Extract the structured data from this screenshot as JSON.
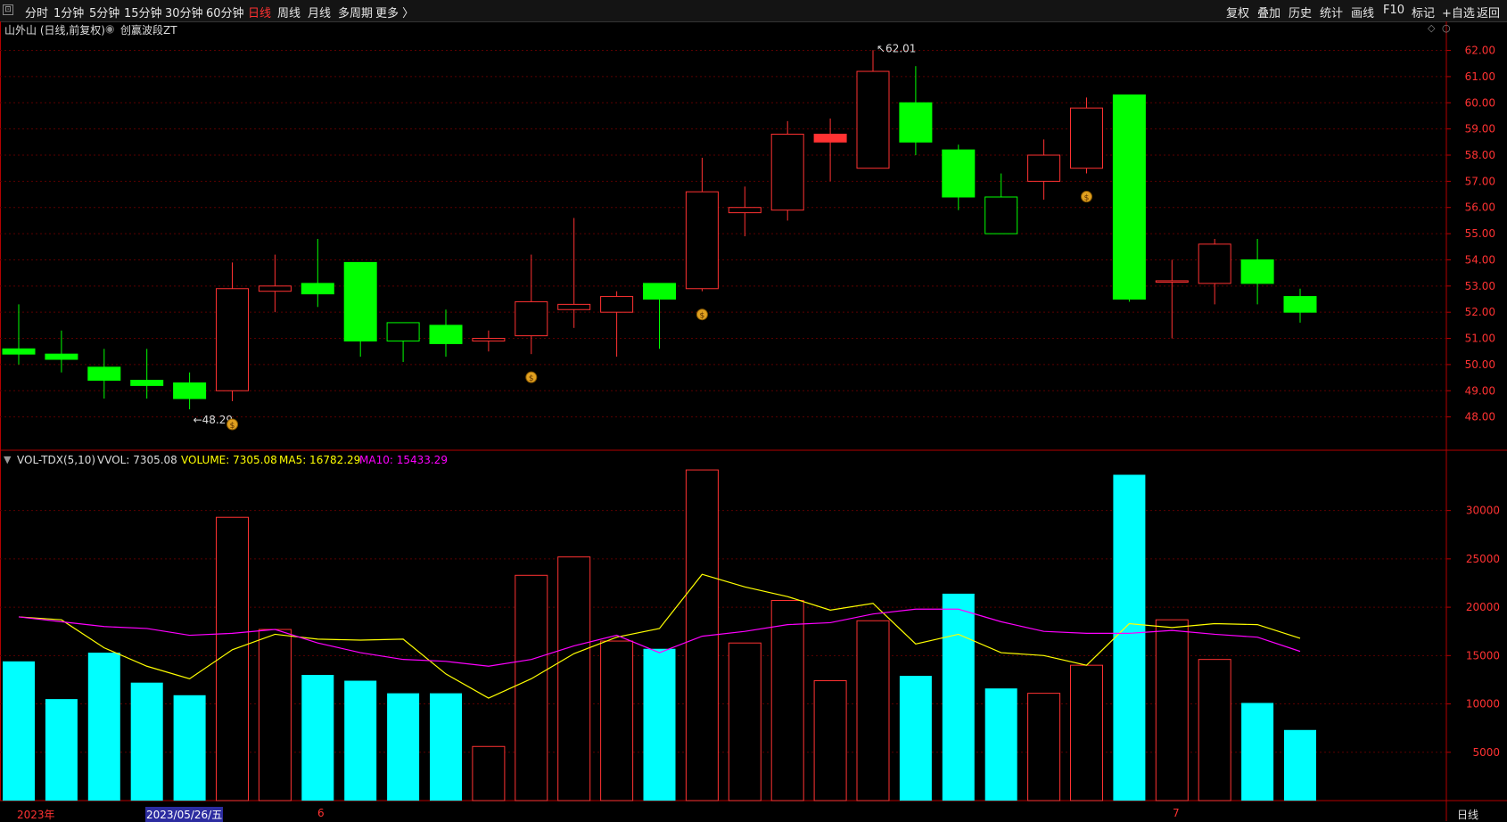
{
  "toolbar": {
    "periods": [
      "分时",
      "1分钟",
      "5分钟",
      "15分钟",
      "30分钟",
      "60分钟",
      "日线",
      "周线",
      "月线",
      "多周期",
      "更多 〉"
    ],
    "active": "日线",
    "right": [
      "复权",
      "叠加",
      "历史",
      "统计",
      "画线",
      "F10",
      "标记",
      "+自选",
      "返回"
    ]
  },
  "price_header": {
    "stock": "山外山 (日线,前复权)",
    "indicator": "创赢波段ZT"
  },
  "volume_header": {
    "name": "VOL-TDX(5,10)",
    "vvol": "VVOL: 7305.08",
    "volume": "VOLUME: 7305.08",
    "ma5": "MA5: 16782.29",
    "ma10": "MA10: 15433.29"
  },
  "bottom": {
    "year": "2023年",
    "date": "2023/05/26/五",
    "m6": "6",
    "m7": "7",
    "period": "日线"
  },
  "colors": {
    "up": "#ff3232",
    "down": "#00ff00",
    "vol_down": "#00ffff",
    "ma5": "#ffff00",
    "ma10": "#ff00ff",
    "axis": "#b40000",
    "grid": "#5a0000"
  },
  "chart_data": [
    {
      "type": "candlestick",
      "ylim": [
        47,
        62.7
      ],
      "y_ticks": [
        48,
        49,
        50,
        51,
        52,
        53,
        54,
        55,
        56,
        57,
        58,
        59,
        60,
        61,
        62
      ],
      "annotations": [
        {
          "text": "48.29",
          "index": 4
        },
        {
          "text": "62.01",
          "index": 20
        }
      ],
      "signal_icon_indices": [
        5,
        12,
        16,
        25
      ],
      "candles": [
        {
          "open": 50.6,
          "high": 52.3,
          "low": 50.0,
          "close": 50.4
        },
        {
          "open": 50.4,
          "high": 51.3,
          "low": 49.7,
          "close": 50.2
        },
        {
          "open": 49.9,
          "high": 50.6,
          "low": 48.7,
          "close": 49.4
        },
        {
          "open": 49.4,
          "high": 50.6,
          "low": 48.7,
          "close": 49.2
        },
        {
          "open": 49.3,
          "high": 49.7,
          "low": 48.29,
          "close": 48.7
        },
        {
          "open": 49.0,
          "high": 53.9,
          "low": 48.6,
          "close": 52.9
        },
        {
          "open": 52.8,
          "high": 54.2,
          "low": 52.0,
          "close": 53.0
        },
        {
          "open": 53.1,
          "high": 54.8,
          "low": 52.2,
          "close": 52.7
        },
        {
          "open": 53.9,
          "high": 53.9,
          "low": 50.3,
          "close": 50.9
        },
        {
          "open": 51.6,
          "high": 51.6,
          "low": 50.1,
          "close": 50.9
        },
        {
          "open": 51.5,
          "high": 52.1,
          "low": 50.3,
          "close": 50.8
        },
        {
          "open": 50.9,
          "high": 51.3,
          "low": 50.5,
          "close": 51.0
        },
        {
          "open": 51.1,
          "high": 54.2,
          "low": 50.4,
          "close": 52.4
        },
        {
          "open": 52.1,
          "high": 55.6,
          "low": 51.4,
          "close": 52.3
        },
        {
          "open": 52.0,
          "high": 52.8,
          "low": 50.3,
          "close": 52.6
        },
        {
          "open": 53.1,
          "high": 53.1,
          "low": 50.6,
          "close": 52.5
        },
        {
          "open": 52.9,
          "high": 57.9,
          "low": 52.8,
          "close": 56.6
        },
        {
          "open": 55.8,
          "high": 56.8,
          "low": 54.9,
          "close": 56.0
        },
        {
          "open": 55.9,
          "high": 59.3,
          "low": 55.5,
          "close": 58.8
        },
        {
          "open": 58.5,
          "high": 59.4,
          "low": 57.0,
          "close": 58.8
        },
        {
          "open": 57.5,
          "high": 62.01,
          "low": 57.5,
          "close": 61.2
        },
        {
          "open": 60.0,
          "high": 61.4,
          "low": 58.0,
          "close": 58.5
        },
        {
          "open": 58.2,
          "high": 58.4,
          "low": 55.9,
          "close": 56.4
        },
        {
          "open": 56.4,
          "high": 57.3,
          "low": 55.0,
          "close": 55.0
        },
        {
          "open": 57.0,
          "high": 58.6,
          "low": 56.3,
          "close": 58.0
        },
        {
          "open": 57.5,
          "high": 60.2,
          "low": 57.3,
          "close": 59.8
        },
        {
          "open": 60.3,
          "high": 60.3,
          "low": 52.4,
          "close": 52.5
        },
        {
          "open": 53.2,
          "high": 54.0,
          "low": 51.0,
          "close": 53.2
        },
        {
          "open": 53.1,
          "high": 54.8,
          "low": 52.3,
          "close": 54.6
        },
        {
          "open": 54.0,
          "high": 54.8,
          "low": 52.3,
          "close": 53.1
        },
        {
          "open": 52.6,
          "high": 52.9,
          "low": 51.6,
          "close": 52.0
        }
      ]
    },
    {
      "type": "bar",
      "title": "VOL-TDX(5,10)",
      "ylim": [
        0,
        34300
      ],
      "y_ticks": [
        5000,
        10000,
        15000,
        20000,
        25000,
        30000
      ],
      "values": [
        14400,
        10500,
        15300,
        12200,
        10900,
        29300,
        17700,
        13000,
        12400,
        11100,
        11100,
        5600,
        23300,
        25200,
        16500,
        15700,
        34200,
        16300,
        20700,
        12400,
        18600,
        12900,
        21400,
        11600,
        11100,
        14000,
        33700,
        18700,
        14600,
        10100,
        7305.08
      ],
      "series": [
        {
          "name": "MA5",
          "values": [
            19000,
            18700,
            15800,
            13900,
            12600,
            15600,
            17200,
            16700,
            16600,
            16700,
            13100,
            10600,
            12600,
            15200,
            16900,
            17800,
            23400,
            22100,
            21100,
            19700,
            20400,
            16200,
            17200,
            15300,
            15000,
            14000,
            18300,
            17900,
            18300,
            18200,
            16782.29
          ]
        },
        {
          "name": "MA10",
          "values": [
            19000,
            18500,
            18000,
            17800,
            17100,
            17300,
            17700,
            16300,
            15300,
            14600,
            14400,
            13900,
            14600,
            16000,
            17100,
            15300,
            17000,
            17500,
            18200,
            18400,
            19300,
            19800,
            19800,
            18500,
            17500,
            17300,
            17300,
            17600,
            17200,
            16900,
            15433.29
          ]
        }
      ]
    }
  ]
}
